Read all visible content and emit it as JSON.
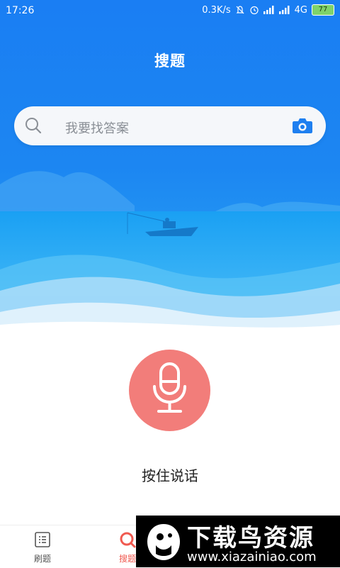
{
  "status_bar": {
    "time": "17:26",
    "network_speed": "0.3K/s",
    "network_type": "4G",
    "battery_level": "77",
    "icons": [
      "mute-icon",
      "alarm-icon",
      "signal-icon",
      "hd-signal-icon"
    ]
  },
  "header": {
    "title": "搜题"
  },
  "search": {
    "placeholder": "我要找答案",
    "icons": [
      "search-icon",
      "camera-icon"
    ]
  },
  "voice": {
    "label": "按住说话",
    "button_color": "#f27d7a",
    "icon": "microphone-icon"
  },
  "bottom_nav": {
    "items": [
      {
        "label": "刷题",
        "icon": "list-icon",
        "active": false
      },
      {
        "label": "搜题",
        "icon": "search-tab-icon",
        "active": true
      }
    ],
    "active_color": "#f05a50"
  },
  "watermark": {
    "title": "下载鸟资源",
    "url": "www.xiazainiao.com"
  },
  "colors": {
    "accent": "#1e7ff0",
    "hero_top": "#1a7cf2",
    "hero_bottom": "#2aa8f5"
  }
}
